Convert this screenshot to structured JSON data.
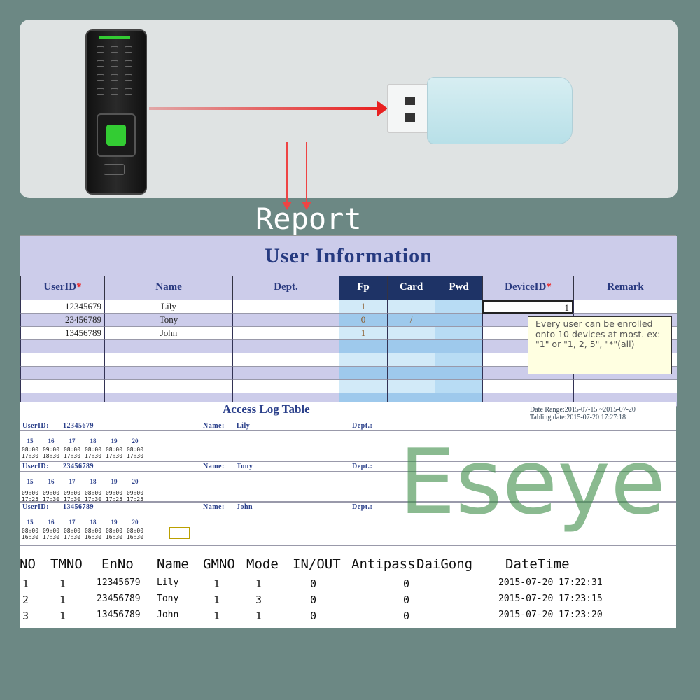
{
  "report_label": "Report",
  "watermark": "Eseye",
  "colors": {
    "background": "#6c8884",
    "arrow": "#e82020",
    "header": "#ccccea",
    "header_dark": "#1e3366",
    "title_text": "#263a80"
  },
  "user_info": {
    "title": "User Information",
    "columns": [
      "UserID",
      "Name",
      "Dept.",
      "Fp",
      "Card",
      "Pwd",
      "DeviceID",
      "Remark"
    ],
    "required_mark": "*",
    "rows": [
      {
        "userid": "12345679",
        "name": "Lily",
        "dept": "",
        "fp": "1",
        "card": "",
        "pwd": "",
        "deviceid": "1",
        "remark": ""
      },
      {
        "userid": "23456789",
        "name": "Tony",
        "dept": "",
        "fp": "0",
        "card": "/",
        "pwd": "",
        "deviceid": "",
        "remark": ""
      },
      {
        "userid": "13456789",
        "name": "John",
        "dept": "",
        "fp": "1",
        "card": "",
        "pwd": "",
        "deviceid": "",
        "remark": ""
      }
    ],
    "tooltip": "Every user can be enrolled onto 10 devices at most. ex: \"1\" or \"1, 2, 5\", \"*\"(all)"
  },
  "access_log": {
    "title": "Access Log Table",
    "date_range": "Date Range:2015-07-15 ~2015-07-20",
    "tabling_date": "Tabling date:2015-07-20 17:27:18",
    "userid_label": "UserID:",
    "name_label": "Name:",
    "dept_label": "Dept.:",
    "days": [
      "15",
      "16",
      "17",
      "18",
      "19",
      "20"
    ],
    "users": [
      {
        "userid": "12345679",
        "name": "Lily",
        "in": [
          "08:00",
          "09:00",
          "08:00",
          "08:00",
          "08:00",
          "08:00"
        ],
        "out": [
          "17:30",
          "18:30",
          "17:30",
          "17:30",
          "17:30",
          "17:30"
        ]
      },
      {
        "userid": "23456789",
        "name": "Tony",
        "in": [
          "09:00",
          "09:00",
          "09:00",
          "08:00",
          "09:00",
          "09:00"
        ],
        "out": [
          "17:25",
          "17:30",
          "17:30",
          "17:30",
          "17:25",
          "17:25"
        ]
      },
      {
        "userid": "13456789",
        "name": "John",
        "in": [
          "08:00",
          "09:00",
          "08:00",
          "08:00",
          "08:00",
          "08:00"
        ],
        "out": [
          "16:30",
          "17:30",
          "17:30",
          "16:30",
          "16:30",
          "16:30"
        ]
      }
    ]
  },
  "records": {
    "headers": [
      "NO",
      "TMNO",
      "EnNo",
      "Name",
      "GMNO",
      "Mode",
      "IN/OUT",
      "Antipass",
      "DaiGong",
      "DateTime"
    ],
    "rows": [
      {
        "no": "1",
        "tmno": "1",
        "enno": "12345679",
        "name": "Lily",
        "gmno": "1",
        "mode": "1",
        "inout": "0",
        "antipass": "0",
        "datetime": "2015-07-20  17:22:31"
      },
      {
        "no": "2",
        "tmno": "1",
        "enno": "23456789",
        "name": "Tony",
        "gmno": "1",
        "mode": "3",
        "inout": "0",
        "antipass": "0",
        "datetime": "2015-07-20  17:23:15"
      },
      {
        "no": "3",
        "tmno": "1",
        "enno": "13456789",
        "name": "John",
        "gmno": "1",
        "mode": "1",
        "inout": "0",
        "antipass": "0",
        "datetime": "2015-07-20  17:23:20"
      }
    ]
  }
}
